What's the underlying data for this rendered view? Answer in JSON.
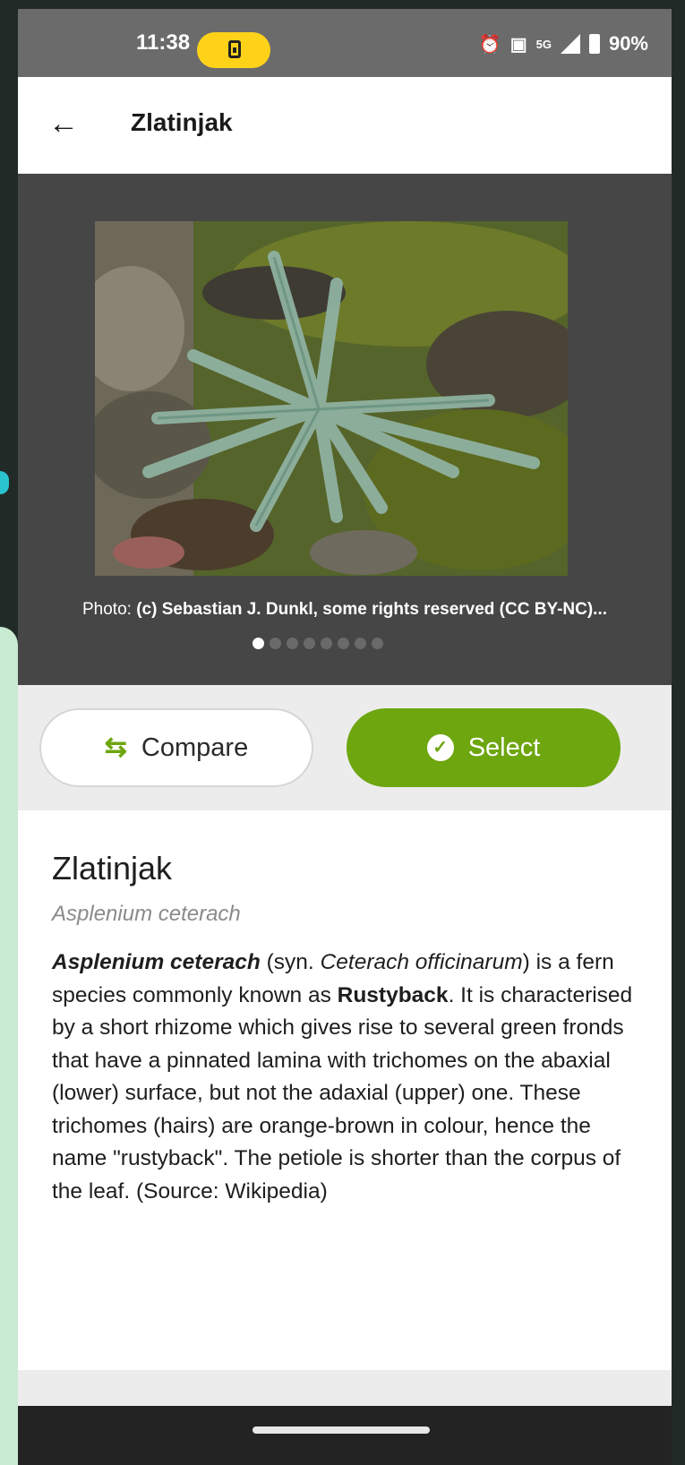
{
  "status_bar": {
    "time": "11:38",
    "fiveg": "5G",
    "battery": "90%"
  },
  "app_bar": {
    "title": "Zlatinjak"
  },
  "gallery": {
    "credit_prefix": "Photo: ",
    "credit_text": "(c) Sebastian J. Dunkl, some rights reserved (CC BY-NC)...",
    "active_index": 0,
    "photo_count": 8
  },
  "actions": {
    "compare_label": "Compare",
    "select_label": "Select"
  },
  "species": {
    "common_name": "Zlatinjak",
    "scientific_name": "Asplenium ceterach",
    "desc_sci": "Asplenium ceterach",
    "desc_syn_pre": " (syn. ",
    "desc_syn": "Ceterach officinarum",
    "desc_mid": ") is a fern species commonly known as ",
    "desc_common": "Rustyback",
    "desc_rest": ". It is characterised by a short rhizome which gives rise to several green fronds that have a pinnated lamina with trichomes on the abaxial (lower) surface, but not the adaxial (upper) one. These trichomes (hairs) are orange-brown in colour, hence the name \"rustyback\". The petiole is shorter than the corpus of the leaf. (Source: Wikipedia)"
  },
  "colors": {
    "accent": "#6da60f",
    "status_pill": "#ffd21a"
  }
}
